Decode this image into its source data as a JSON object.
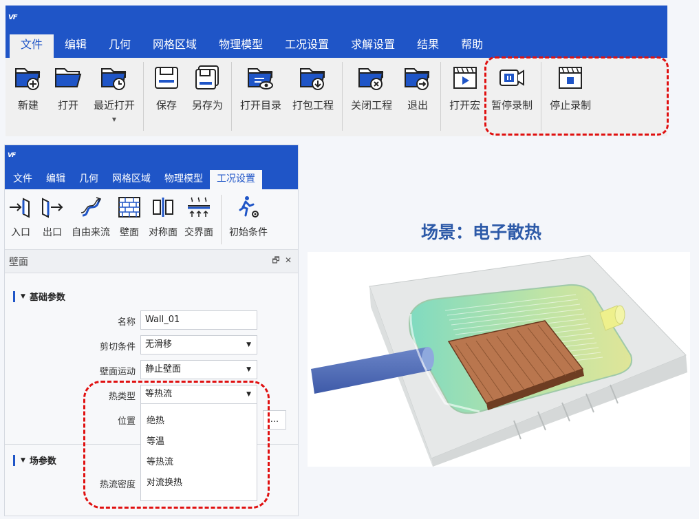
{
  "app": {
    "logo": "VF"
  },
  "main_window": {
    "menu": [
      "文件",
      "编辑",
      "几何",
      "网格区域",
      "物理模型",
      "工况设置",
      "求解设置",
      "结果",
      "帮助"
    ],
    "ribbon_groups": [
      [
        {
          "label": "新建",
          "icon": "folder-new-icon"
        },
        {
          "label": "打开",
          "icon": "folder-open-icon"
        },
        {
          "label": "最近打开",
          "icon": "folder-recent-icon"
        }
      ],
      [
        {
          "label": "保存",
          "icon": "save-icon"
        },
        {
          "label": "另存为",
          "icon": "save-as-icon"
        }
      ],
      [
        {
          "label": "打开目录",
          "icon": "folder-view-icon"
        },
        {
          "label": "打包工程",
          "icon": "folder-pack-icon"
        }
      ],
      [
        {
          "label": "关闭工程",
          "icon": "folder-close-icon"
        },
        {
          "label": "退出",
          "icon": "folder-exit-icon"
        }
      ],
      [
        {
          "label": "打开宏",
          "icon": "macro-play-icon"
        },
        {
          "label": "暂停录制",
          "icon": "record-pause-icon"
        }
      ],
      [
        {
          "label": "停止录制",
          "icon": "record-stop-icon"
        }
      ]
    ]
  },
  "second_window": {
    "menu": [
      "文件",
      "编辑",
      "几何",
      "网格区域",
      "物理模型",
      "工况设置"
    ],
    "ribbon": [
      {
        "label": "入口",
        "icon": "inlet-icon"
      },
      {
        "label": "出口",
        "icon": "outlet-icon"
      },
      {
        "label": "自由来流",
        "icon": "freestream-icon"
      },
      {
        "label": "壁面",
        "icon": "wall-icon"
      },
      {
        "label": "对称面",
        "icon": "symmetry-icon"
      },
      {
        "label": "交界面",
        "icon": "interface-icon"
      },
      {
        "label": "初始条件",
        "icon": "initial-condition-icon"
      }
    ],
    "panel": {
      "title": "壁面",
      "section_basic": "基础参数",
      "section_field": "场参数",
      "fields": {
        "name_label": "名称",
        "name_value": "Wall_01",
        "shear_label": "剪切条件",
        "shear_value": "无滑移",
        "motion_label": "壁面运动",
        "motion_value": "静止壁面",
        "heat_label": "热类型",
        "heat_value": "等热流",
        "position_label": "位置",
        "position_button": "...",
        "heat_flux_label": "热流密度"
      },
      "heat_options": [
        "绝热",
        "等温",
        "等热流",
        "对流换热"
      ]
    }
  },
  "scene": {
    "title": "场景：电子散热"
  },
  "colors": {
    "brand_blue": "#1f55c7",
    "highlight_red": "#e01010",
    "scene_title": "#2d5aa8"
  }
}
